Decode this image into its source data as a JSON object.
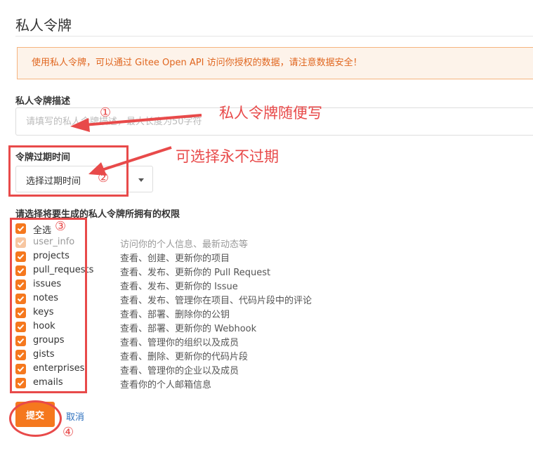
{
  "page": {
    "title": "私人令牌",
    "notice": "使用私人令牌，可以通过 Gitee Open API 访问你授权的数据，请注意数据安全！"
  },
  "form": {
    "desc_label": "私人令牌描述",
    "desc_placeholder": "请填写的私人令牌描述，最大长度为50字符",
    "expiry_label": "令牌过期时间",
    "expiry_select_value": "选择过期时间",
    "perm_label": "请选择将要生成的私人令牌所拥有的权限",
    "select_all": "全选",
    "permissions": [
      {
        "scope": "user_info",
        "desc": "访问你的个人信息、最新动态等",
        "checked": true,
        "disabled": true
      },
      {
        "scope": "projects",
        "desc": "查看、创建、更新你的项目",
        "checked": true,
        "disabled": false
      },
      {
        "scope": "pull_requests",
        "desc": "查看、发布、更新你的 Pull Request",
        "checked": true,
        "disabled": false
      },
      {
        "scope": "issues",
        "desc": "查看、发布、更新你的 Issue",
        "checked": true,
        "disabled": false
      },
      {
        "scope": "notes",
        "desc": "查看、发布、管理你在项目、代码片段中的评论",
        "checked": true,
        "disabled": false
      },
      {
        "scope": "keys",
        "desc": "查看、部署、删除你的公钥",
        "checked": true,
        "disabled": false
      },
      {
        "scope": "hook",
        "desc": "查看、部署、更新你的 Webhook",
        "checked": true,
        "disabled": false
      },
      {
        "scope": "groups",
        "desc": "查看、管理你的组织以及成员",
        "checked": true,
        "disabled": false
      },
      {
        "scope": "gists",
        "desc": "查看、删除、更新你的代码片段",
        "checked": true,
        "disabled": false
      },
      {
        "scope": "enterprises",
        "desc": "查看、管理你的企业以及成员",
        "checked": true,
        "disabled": false
      },
      {
        "scope": "emails",
        "desc": "查看你的个人邮箱信息",
        "checked": true,
        "disabled": false
      }
    ],
    "submit_label": "提交",
    "cancel_label": "取消"
  },
  "annotations": {
    "note_desc": "私人令牌随便写",
    "note_expiry": "可选择永不过期",
    "num1": "①",
    "num2": "②",
    "num3": "③",
    "num4": "④"
  },
  "colors": {
    "accent": "#f5781e",
    "annotation": "#e84a4a",
    "link": "#2a6ebd",
    "notice_bg": "#fdf3ea",
    "notice_text": "#e0661f"
  }
}
